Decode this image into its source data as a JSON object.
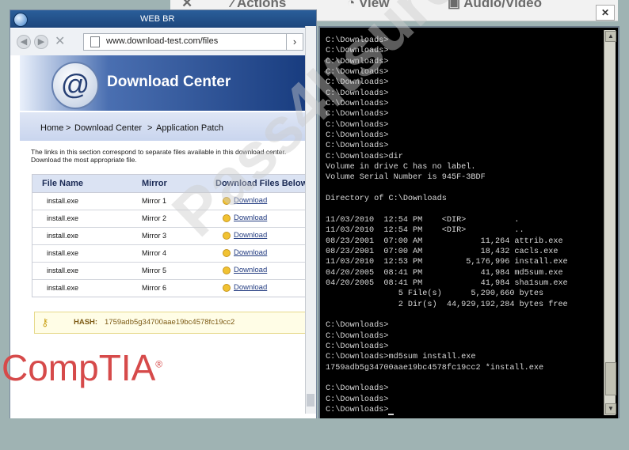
{
  "toolbar": {
    "actions_label": "Actions",
    "view_label": "View",
    "audio_video_label": "Audio/Video",
    "close_glyph": "✕"
  },
  "browser": {
    "title": "WEB BR",
    "address": "www.download-test.com/files",
    "banner_title": "Download Center",
    "breadcrumb": [
      "Home",
      "Download Center",
      "Application Patch"
    ],
    "breadcrumb_separator": ">",
    "intro_text": "The links in this section correspond to separate files available in this download center. Download the most appropriate file.",
    "table": {
      "headers": [
        "File Name",
        "Mirror",
        "Download Files Below"
      ],
      "rows": [
        {
          "file": "install.exe",
          "mirror": "Mirror 1",
          "link": "Download"
        },
        {
          "file": "install.exe",
          "mirror": "Mirror 2",
          "link": "Download"
        },
        {
          "file": "install.exe",
          "mirror": "Mirror 3",
          "link": "Download"
        },
        {
          "file": "install.exe",
          "mirror": "Mirror 4",
          "link": "Download"
        },
        {
          "file": "install.exe",
          "mirror": "Mirror 5",
          "link": "Download"
        },
        {
          "file": "install.exe",
          "mirror": "Mirror 6",
          "link": "Download"
        }
      ]
    },
    "hash_label": "HASH:",
    "hash_value": "1759adb5g34700aae19bc4578fc19cc2"
  },
  "terminal": {
    "text": "C:\\Downloads>\nC:\\Downloads>\nC:\\Downloads>\nC:\\Downloads>\nC:\\Downloads>\nC:\\Downloads>\nC:\\Downloads>\nC:\\Downloads>\nC:\\Downloads>\nC:\\Downloads>\nC:\\Downloads>\nC:\\Downloads>dir\nVolume in drive C has no label.\nVolume Serial Number is 945F-3BDF\n\nDirectory of C:\\Downloads\n\n11/03/2010  12:54 PM    <DIR>          .\n11/03/2010  12:54 PM    <DIR>          ..\n08/23/2001  07:00 AM            11,264 attrib.exe\n08/23/2001  07:00 AM            18,432 cacls.exe\n11/03/2010  12:53 PM         5,176,996 install.exe\n04/20/2005  08:41 PM            41,984 md5sum.exe\n04/20/2005  08:41 PM            41,984 sha1sum.exe\n               5 File(s)      5,290,660 bytes\n               2 Dir(s)  44,929,192,284 bytes free\n\nC:\\Downloads>\nC:\\Downloads>\nC:\\Downloads>\nC:\\Downloads>md5sum install.exe\n1759adb5g34700aae19bc4578fc19cc2 *install.exe\n\nC:\\Downloads>\nC:\\Downloads>\nC:\\Downloads>"
  },
  "watermarks": {
    "brand": "CompTIA",
    "site": "Pass4Itsure"
  },
  "colors": {
    "banner_dark": "#163a7d",
    "terminal_bg": "#000000",
    "terminal_fg": "#d8d8d8",
    "brand_red": "#d64a4a"
  }
}
